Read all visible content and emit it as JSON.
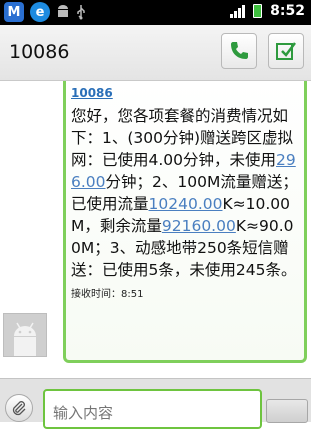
{
  "status_bar": {
    "time": "8:52",
    "icons": [
      "m-app-icon",
      "e-app-icon",
      "android-icon",
      "usb-icon",
      "signal-icon",
      "battery-icon"
    ],
    "app_letters": {
      "m": "M",
      "e": "e"
    }
  },
  "header": {
    "title": "10086"
  },
  "message": {
    "sender": "10086",
    "text_parts": [
      "您好，您各项套餐的消费情况如下：1、(300分钟)赠送跨区虚拟网：已使用4.00分钟，未使用",
      "296.00",
      "分钟；2、100M流量赠送；已使用流量",
      "10240.00",
      "K≈10.00M，剩余流量",
      "92160.00",
      "K≈90.00M；3、动感地带250条短信赠送：已使用5条，未使用245条。"
    ],
    "received_time": "接收时间：8:51"
  },
  "compose": {
    "placeholder": "输入内容"
  },
  "colors": {
    "accent_green": "#7fcf5b",
    "link_blue": "#4a7fc0"
  }
}
